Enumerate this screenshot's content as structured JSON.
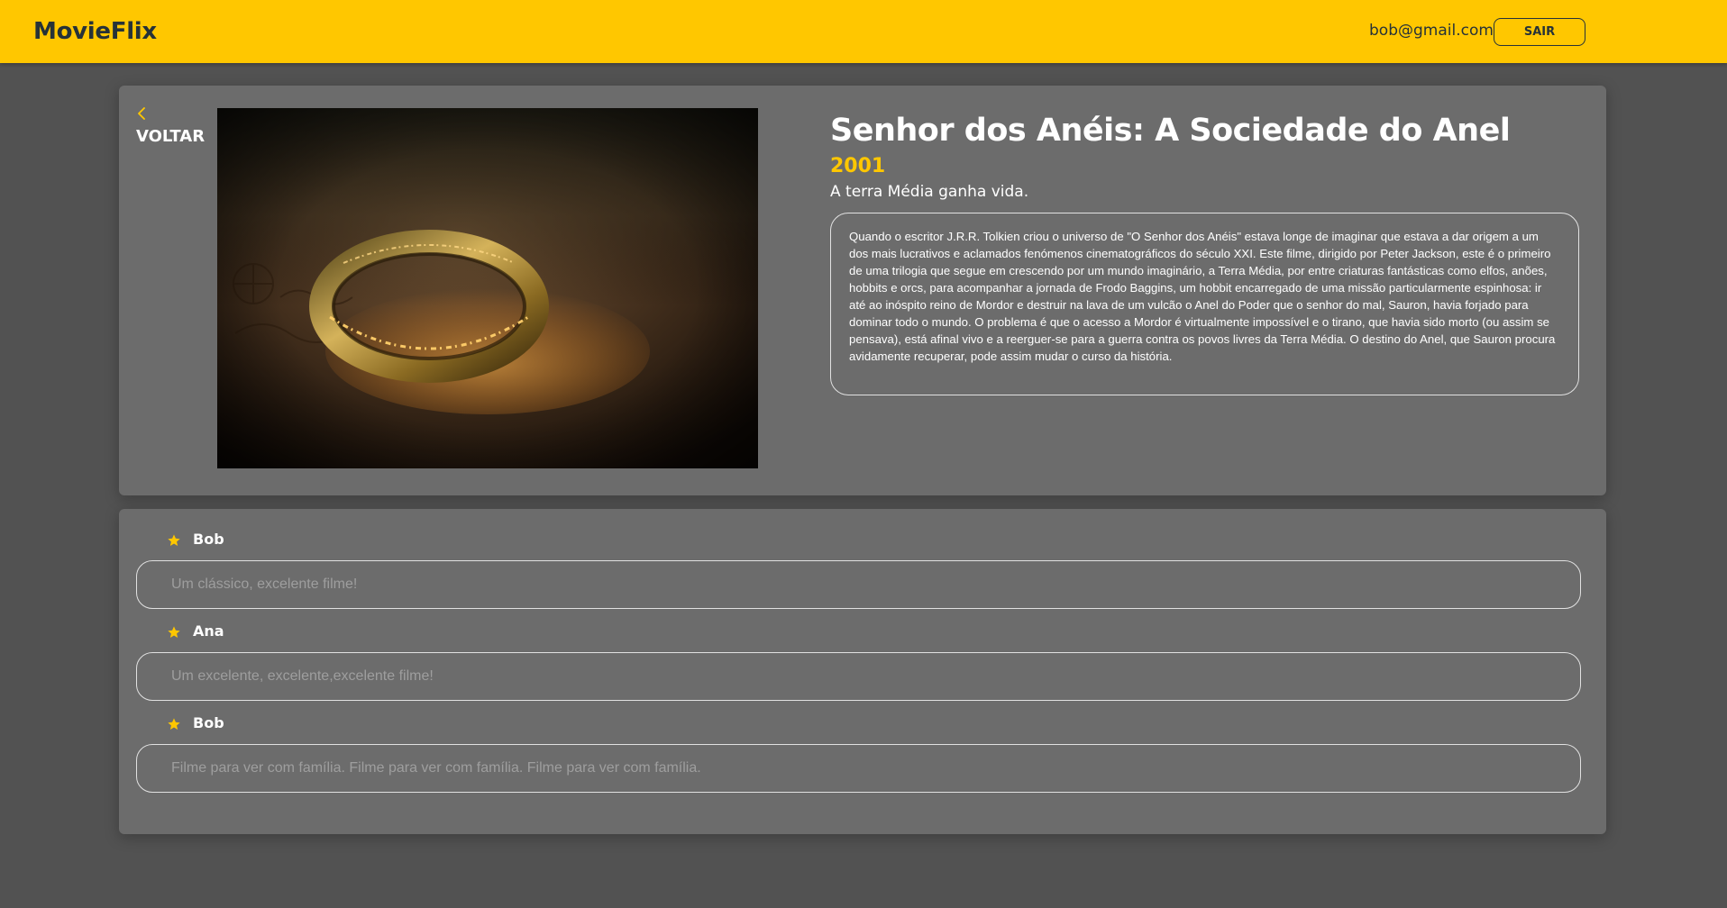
{
  "navbar": {
    "brand": "MovieFlix",
    "user_email": "bob@gmail.com",
    "logout_label": "SAIR",
    "color": "#FFC700"
  },
  "movie": {
    "back_label": "VOLTAR",
    "title": "Senhor dos Anéis: A Sociedade do Anel",
    "year": "2001",
    "subtitle": "A terra Média ganha vida.",
    "synopsis": "Quando o escritor J.R.R. Tolkien criou o universo de \"O Senhor dos Anéis\" estava longe de imaginar que estava a dar origem a um dos mais lucrativos e aclamados fenómenos cinematográficos do século XXI. Este filme, dirigido por Peter Jackson, este é o primeiro de uma trilogia que segue em crescendo por um mundo imaginário, a Terra Média, por entre criaturas fantásticas como elfos, anões, hobbits e orcs, para acompanhar a jornada de Frodo Baggins, um hobbit encarregado de uma missão particularmente espinhosa: ir até ao inóspito reino de Mordor e destruir na lava de um vulcão o Anel do Poder que o senhor do mal, Sauron, havia forjado para dominar todo o mundo. O problema é que o acesso a Mordor é virtualmente impossível e o tirano, que havia sido morto (ou assim se pensava), está afinal vivo e a reerguer-se para a guerra contra os povos livres da Terra Média. O destino do Anel, que Sauron procura avidamente recuperar, pode assim mudar o curso da história."
  },
  "reviews": [
    {
      "author": "Bob",
      "text": "Um clássico, excelente filme!",
      "icon": "star-icon"
    },
    {
      "author": "Ana",
      "text": "Um excelente, excelente,excelente filme!",
      "icon": "star-icon"
    },
    {
      "author": "Bob",
      "text": "Filme para ver com família. Filme para ver com família. Filme para ver com família.",
      "icon": "star-icon"
    }
  ],
  "colors": {
    "background": "#525252",
    "card": "#6C6C6C",
    "accent": "#FFC700"
  }
}
